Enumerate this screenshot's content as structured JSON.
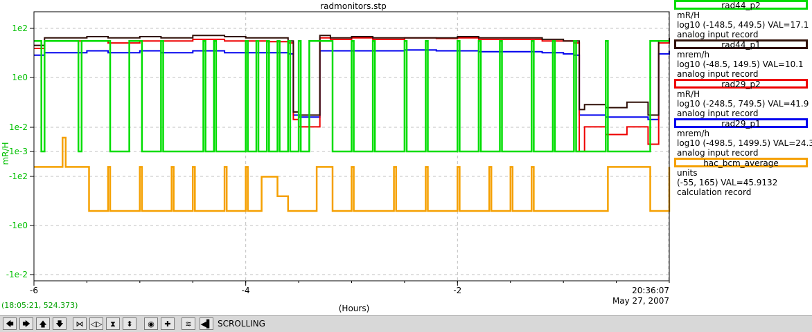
{
  "chart_data": {
    "type": "line",
    "title": "radmonitors.stp",
    "ylabel": "mR/H",
    "xlabel": "(Hours)",
    "y_tick_labels": [
      "1e2",
      "1e0",
      "1e-2",
      "1e-3",
      "-1e2",
      "-1e0",
      "-1e-2"
    ],
    "x_tick_labels": [
      "-6",
      "-4",
      "-2"
    ],
    "xlim": [
      -6.0,
      0.0
    ],
    "grid": true,
    "time_label": "20:36:07",
    "date_label": "May 27, 2007",
    "cursor_readout": "(18:05:21, 524.373)",
    "series": [
      {
        "name": "rad44_p2",
        "color": "#00dd00",
        "x": [
          -6.0,
          -5.95,
          -5.93,
          -5.9,
          -5.6,
          -5.58,
          -5.55,
          -5.3,
          -5.28,
          -5.1,
          -5.0,
          -4.98,
          -4.8,
          -4.78,
          -4.4,
          -4.38,
          -4.3,
          -4.28,
          -4.0,
          -3.98,
          -3.9,
          -3.88,
          -3.8,
          -3.78,
          -3.7,
          -3.68,
          -3.6,
          -3.58,
          -3.5,
          -3.48,
          -3.4,
          -3.38,
          -3.2,
          -3.18,
          -3.0,
          -2.98,
          -2.8,
          -2.78,
          -2.5,
          -2.48,
          -2.3,
          -2.28,
          -2.0,
          -1.98,
          -1.8,
          -1.78,
          -1.6,
          -1.58,
          -1.3,
          -1.28,
          -1.1,
          -1.08,
          -0.9,
          -0.88,
          -0.6,
          -0.58,
          -0.2,
          -0.18,
          0.0
        ],
        "values": [
          30,
          30,
          0.001,
          30,
          30,
          0.001,
          30,
          30,
          0.001,
          30,
          30,
          0.001,
          30,
          0.001,
          30,
          0.001,
          30,
          0.001,
          30,
          0.001,
          30,
          0.001,
          30,
          0.001,
          30,
          0.001,
          30,
          0.001,
          30,
          0.001,
          30,
          30,
          30,
          0.001,
          30,
          0.001,
          30,
          0.001,
          30,
          0.001,
          30,
          0.001,
          30,
          0.001,
          30,
          0.001,
          30,
          0.001,
          30,
          0.001,
          30,
          0.001,
          30,
          0.001,
          30,
          0.001,
          0.001,
          30,
          30
        ]
      },
      {
        "name": "rad44_p1",
        "color": "#301008",
        "x": [
          -6.0,
          -5.9,
          -5.8,
          -5.5,
          -5.3,
          -5.0,
          -4.8,
          -4.5,
          -4.2,
          -4.0,
          -3.8,
          -3.6,
          -3.55,
          -3.5,
          -3.4,
          -3.3,
          -3.2,
          -3.0,
          -2.8,
          -2.5,
          -2.2,
          -2.0,
          -1.8,
          -1.5,
          -1.2,
          -1.0,
          -0.9,
          -0.85,
          -0.8,
          -0.6,
          -0.4,
          -0.2,
          -0.1,
          0.0
        ],
        "values": [
          20,
          40,
          40,
          45,
          40,
          45,
          40,
          50,
          45,
          40,
          40,
          30,
          0.04,
          0.03,
          0.03,
          50,
          40,
          45,
          40,
          40,
          40,
          45,
          40,
          40,
          35,
          30,
          30,
          0.05,
          0.08,
          0.06,
          0.1,
          0.03,
          30,
          40
        ]
      },
      {
        "name": "rad29_p2",
        "color": "#ee0000",
        "x": [
          -6.0,
          -5.9,
          -5.8,
          -5.5,
          -5.3,
          -5.0,
          -4.8,
          -4.5,
          -4.2,
          -4.0,
          -3.8,
          -3.6,
          -3.55,
          -3.5,
          -3.4,
          -3.3,
          -3.2,
          -3.0,
          -2.8,
          -2.5,
          -2.2,
          -2.0,
          -1.8,
          -1.5,
          -1.2,
          -1.0,
          -0.9,
          -0.85,
          -0.8,
          -0.6,
          -0.4,
          -0.2,
          -0.1,
          0.0
        ],
        "values": [
          15,
          30,
          30,
          30,
          25,
          30,
          30,
          35,
          30,
          30,
          28,
          25,
          0.02,
          0.01,
          0.01,
          40,
          35,
          40,
          35,
          40,
          38,
          40,
          35,
          35,
          30,
          30,
          25,
          0.001,
          0.01,
          0.005,
          0.01,
          0.002,
          25,
          35
        ]
      },
      {
        "name": "rad29_p1",
        "color": "#0000ee",
        "x": [
          -6.0,
          -5.9,
          -5.8,
          -5.5,
          -5.3,
          -5.0,
          -4.8,
          -4.5,
          -4.2,
          -4.0,
          -3.8,
          -3.6,
          -3.55,
          -3.5,
          -3.4,
          -3.3,
          -3.2,
          -3.0,
          -2.8,
          -2.5,
          -2.2,
          -2.0,
          -1.8,
          -1.5,
          -1.2,
          -1.0,
          -0.9,
          -0.85,
          -0.8,
          -0.6,
          -0.4,
          -0.2,
          -0.1,
          0.0
        ],
        "values": [
          8,
          10,
          10,
          12,
          10,
          12,
          10,
          12,
          10,
          10,
          10,
          9,
          0.03,
          0.025,
          0.025,
          12,
          12,
          12,
          12,
          13,
          12,
          12,
          11,
          11,
          10,
          9,
          8,
          0.03,
          0.03,
          0.025,
          0.025,
          0.02,
          9,
          12
        ]
      },
      {
        "name": "hac_bcm_average",
        "color": "#f5a000",
        "x": [
          -6.0,
          -5.75,
          -5.73,
          -5.7,
          -5.5,
          -5.48,
          -5.3,
          -5.28,
          -5.0,
          -4.98,
          -4.7,
          -4.68,
          -4.5,
          -4.48,
          -4.2,
          -4.18,
          -4.0,
          -3.98,
          -3.85,
          -3.7,
          -3.6,
          -3.55,
          -3.35,
          -3.33,
          -3.2,
          -3.18,
          -3.0,
          -2.98,
          -2.6,
          -2.58,
          -2.3,
          -2.28,
          -2.0,
          -1.98,
          -1.7,
          -1.68,
          -1.5,
          -1.48,
          -1.3,
          -1.28,
          -0.9,
          -0.6,
          -0.58,
          -0.2,
          -0.18,
          0.0
        ],
        "values": [
          100,
          100,
          160,
          100,
          100,
          10,
          100,
          10,
          100,
          10,
          100,
          10,
          100,
          10,
          100,
          10,
          100,
          10,
          80,
          40,
          10,
          10,
          10,
          100,
          100,
          10,
          100,
          10,
          100,
          10,
          100,
          10,
          100,
          10,
          100,
          10,
          100,
          10,
          100,
          10,
          10,
          10,
          100,
          100,
          10,
          100
        ]
      }
    ]
  },
  "legend": [
    {
      "name": "rad44_p2",
      "color": "#00dd00",
      "units": "mR/H",
      "range": "log10 (-148.5, 449.5) VAL=17.1",
      "record": "analog input record"
    },
    {
      "name": "rad44_p1",
      "color": "#301008",
      "units": "mrem/h",
      "range": "log10 (-48.5, 149.5) VAL=10.1",
      "record": "analog input record"
    },
    {
      "name": "rad29_p2",
      "color": "#ee0000",
      "units": "mR/H",
      "range": "log10 (-248.5, 749.5) VAL=41.9",
      "record": "analog input record"
    },
    {
      "name": "rad29_p1",
      "color": "#0000ee",
      "units": "mrem/h",
      "range": "log10 (-498.5, 1499.5) VAL=24.3",
      "record": "analog input record"
    },
    {
      "name": "hac_bcm_average",
      "color": "#f5a000",
      "units": "units",
      "range": "(-55, 165) VAL=45.9132",
      "record": "calculation record"
    }
  ],
  "toolbar": {
    "buttons": [
      {
        "name": "scroll-left",
        "glyph": "🡄"
      },
      {
        "name": "scroll-right",
        "glyph": "🡆"
      },
      {
        "name": "scroll-up",
        "glyph": "🡅"
      },
      {
        "name": "scroll-down",
        "glyph": "🡇"
      },
      {
        "name": "zoom-in-x",
        "glyph": "⋈"
      },
      {
        "name": "zoom-out-x",
        "glyph": "◁▷"
      },
      {
        "name": "zoom-in-y",
        "glyph": "⧗"
      },
      {
        "name": "zoom-out-y",
        "glyph": "⬍"
      },
      {
        "name": "autoscale",
        "glyph": "◉"
      },
      {
        "name": "reset",
        "glyph": "✚"
      },
      {
        "name": "auto-scale-wave",
        "glyph": "≋"
      },
      {
        "name": "mode-toggle",
        "glyph": "◀▌"
      }
    ],
    "mode_label": "SCROLLING"
  }
}
